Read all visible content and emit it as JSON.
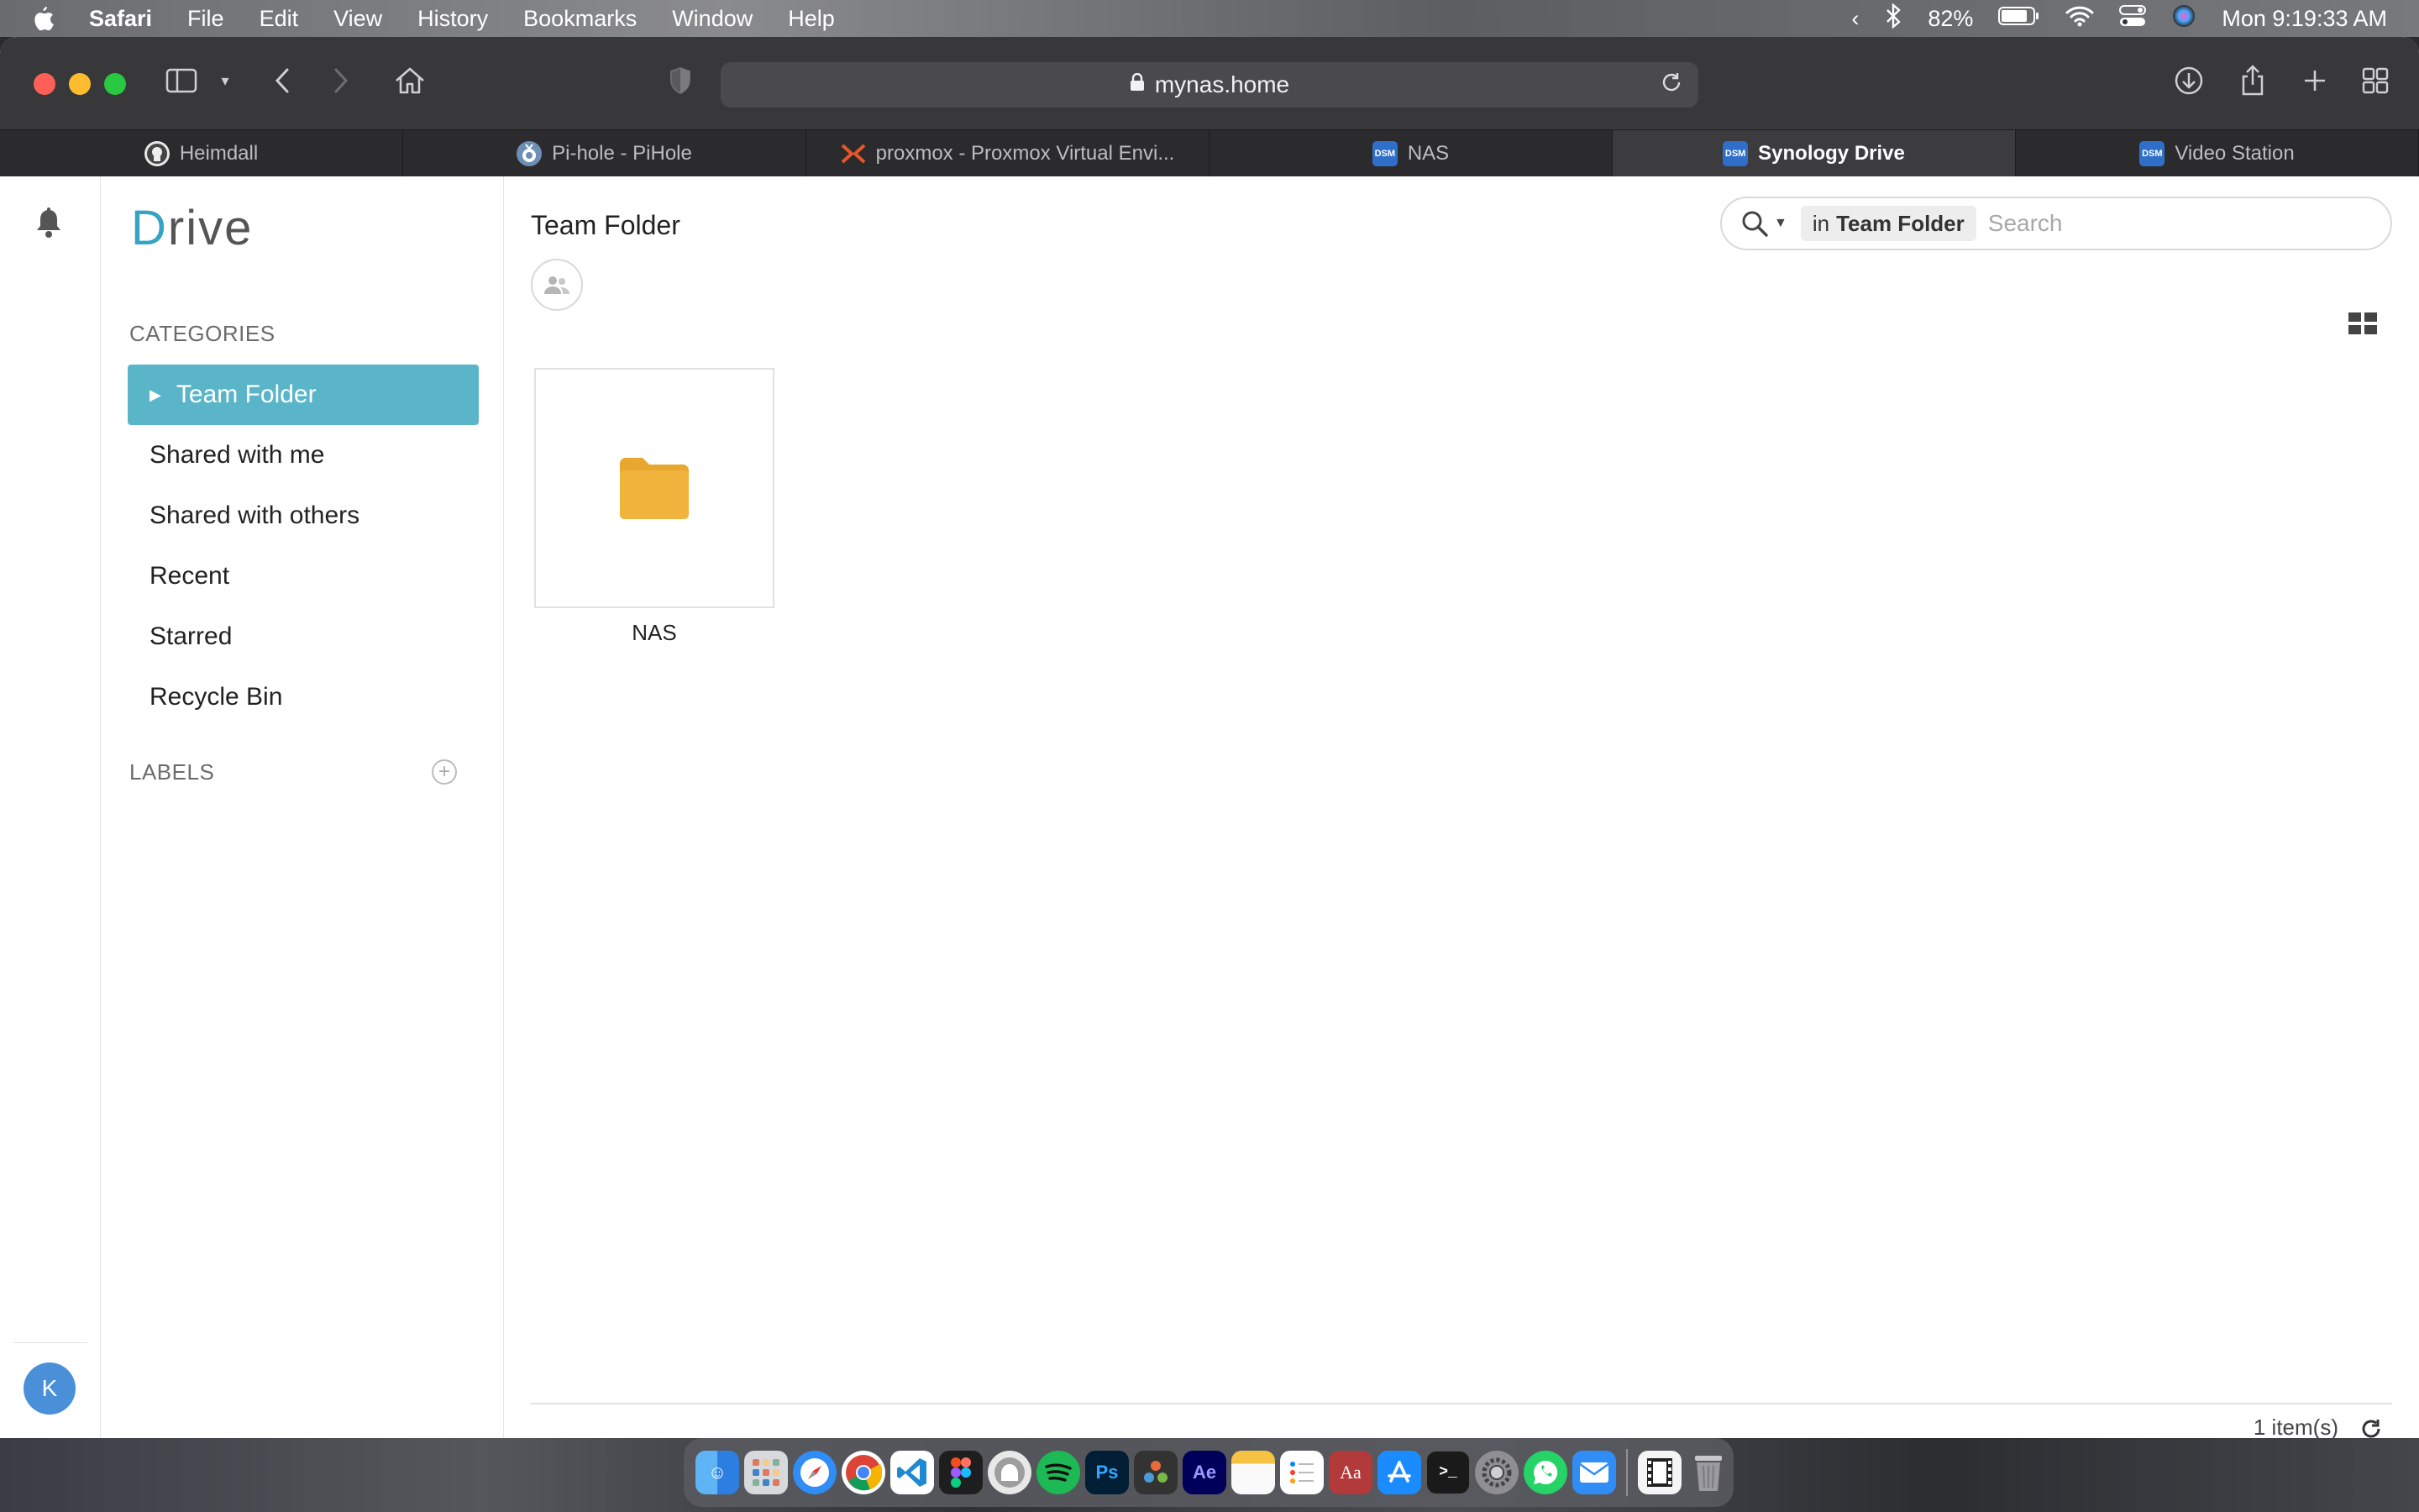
{
  "menubar": {
    "app_name": "Safari",
    "items": [
      "File",
      "Edit",
      "View",
      "History",
      "Bookmarks",
      "Window",
      "Help"
    ],
    "battery": "82%",
    "clock": "Mon  9:19:33 AM"
  },
  "browser": {
    "url": "mynas.home",
    "tabs": [
      {
        "label": "Heimdall",
        "icon": "heimdall-icon"
      },
      {
        "label": "Pi-hole - PiHole",
        "icon": "pihole-icon"
      },
      {
        "label": "proxmox - Proxmox Virtual Envi...",
        "icon": "proxmox-icon"
      },
      {
        "label": "NAS",
        "icon": "dsm-icon",
        "favicon_text": "DSM"
      },
      {
        "label": "Synology Drive",
        "icon": "dsm-icon",
        "favicon_text": "DSM",
        "active": true
      },
      {
        "label": "Video Station",
        "icon": "dsm-icon",
        "favicon_text": "DSM"
      }
    ]
  },
  "drive": {
    "logo_first": "D",
    "logo_rest": "rive",
    "categories_label": "CATEGORIES",
    "nav": [
      {
        "label": "Team Folder",
        "active": true
      },
      {
        "label": "Shared with me"
      },
      {
        "label": "Shared with others"
      },
      {
        "label": "Recent"
      },
      {
        "label": "Starred"
      },
      {
        "label": "Recycle Bin"
      }
    ],
    "labels_label": "LABELS",
    "avatar_initial": "K"
  },
  "main": {
    "title": "Team Folder",
    "search": {
      "scope_prefix": "in",
      "scope": "Team Folder",
      "placeholder": "Search"
    },
    "items": [
      {
        "name": "NAS",
        "type": "folder"
      }
    ],
    "item_count": "1 item(s)"
  },
  "colors": {
    "accent": "#5bb5c9",
    "folder": "#f0b43c",
    "avatar": "#4a90d9"
  },
  "dock": {
    "apps": [
      "Finder",
      "Launchpad",
      "Safari",
      "Chrome",
      "VS Code",
      "Figma",
      "TablePlus",
      "Spotify",
      "Photoshop",
      "DaVinci Resolve",
      "After Effects",
      "Notes",
      "Reminders",
      "Dictionary",
      "App Store",
      "Terminal",
      "System Preferences",
      "WhatsApp",
      "Mail",
      "Movie",
      "Trash"
    ]
  }
}
